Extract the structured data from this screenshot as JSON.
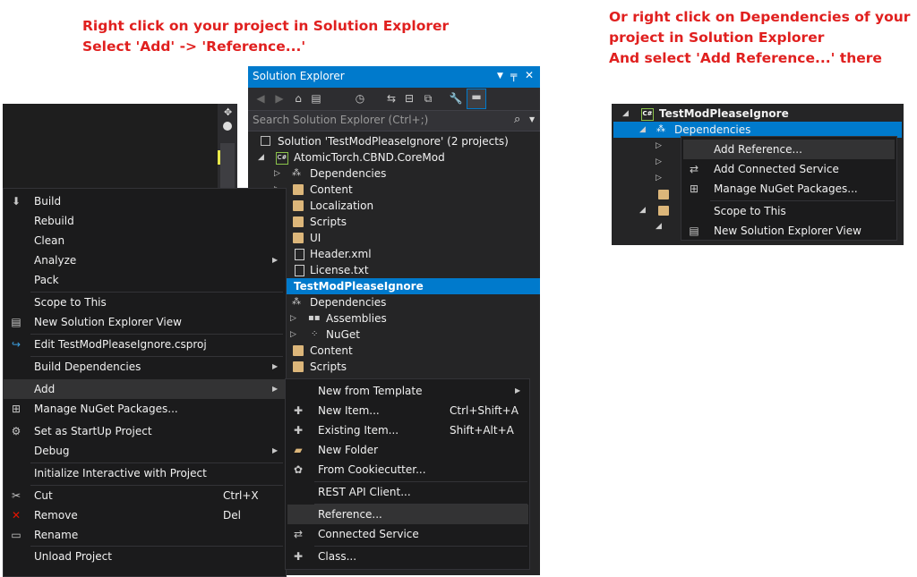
{
  "instructions": {
    "left": [
      "Right click on your project in Solution Explorer",
      "Select 'Add' -> 'Reference...'"
    ],
    "right": [
      "Or right click on Dependencies of your",
      "project in Solution Explorer",
      "And select 'Add Reference...' there"
    ]
  },
  "solution_explorer": {
    "title": "Solution Explorer",
    "search_placeholder": "Search Solution Explorer (Ctrl+;)",
    "tree": [
      {
        "label": "Solution 'TestModPleaseIgnore' (2 projects)",
        "icon": "solution-icon"
      },
      {
        "label": "AtomicTorch.CBND.CoreMod",
        "icon": "csharp-project-icon"
      },
      {
        "label": "Dependencies",
        "icon": "dependencies-icon"
      },
      {
        "label": "Content",
        "icon": "folder-icon"
      },
      {
        "label": "Localization",
        "icon": "folder-icon"
      },
      {
        "label": "Scripts",
        "icon": "folder-icon"
      },
      {
        "label": "UI",
        "icon": "folder-icon"
      },
      {
        "label": "Header.xml",
        "icon": "xml-file-icon"
      },
      {
        "label": "License.txt",
        "icon": "text-file-icon"
      },
      {
        "label": "TestModPleaseIgnore",
        "icon": "csharp-project-icon"
      },
      {
        "label": "Dependencies",
        "icon": "dependencies-icon"
      },
      {
        "label": "Assemblies",
        "icon": "assemblies-icon"
      },
      {
        "label": "NuGet",
        "icon": "nuget-icon"
      },
      {
        "label": "Content",
        "icon": "folder-icon"
      },
      {
        "label": "Scripts",
        "icon": "folder-icon"
      }
    ]
  },
  "context_menu": {
    "items": [
      {
        "label": "Build",
        "icon": "build-icon"
      },
      {
        "label": "Rebuild"
      },
      {
        "label": "Clean"
      },
      {
        "label": "Analyze"
      },
      {
        "label": "Pack"
      },
      {
        "label": "Scope to This"
      },
      {
        "label": "New Solution Explorer View",
        "icon": "new-view-icon"
      },
      {
        "label": "Edit TestModPleaseIgnore.csproj",
        "icon": "edit-icon"
      },
      {
        "label": "Build Dependencies"
      },
      {
        "label": "Add"
      },
      {
        "label": "Manage NuGet Packages...",
        "icon": "nuget-icon"
      },
      {
        "label": "Set as StartUp Project",
        "icon": "gear-icon"
      },
      {
        "label": "Debug"
      },
      {
        "label": "Initialize Interactive with Project"
      },
      {
        "label": "Cut",
        "icon": "cut-icon",
        "shortcut": "Ctrl+X"
      },
      {
        "label": "Remove",
        "icon": "remove-icon",
        "shortcut": "Del"
      },
      {
        "label": "Rename",
        "icon": "rename-icon"
      },
      {
        "label": "Unload Project"
      }
    ]
  },
  "add_submenu": {
    "items": [
      {
        "label": "New from Template"
      },
      {
        "label": "New Item...",
        "shortcut": "Ctrl+Shift+A"
      },
      {
        "label": "Existing Item...",
        "shortcut": "Shift+Alt+A"
      },
      {
        "label": "New Folder"
      },
      {
        "label": "From Cookiecutter..."
      },
      {
        "label": "REST API Client..."
      },
      {
        "label": "Reference..."
      },
      {
        "label": "Connected Service"
      },
      {
        "label": "Class..."
      }
    ]
  },
  "right_panel": {
    "project": "TestModPleaseIgnore",
    "dependencies": "Dependencies",
    "menu": [
      "Add Reference...",
      "Add Connected Service",
      "Manage NuGet Packages...",
      "Scope to This",
      "New Solution Explorer View"
    ]
  },
  "colors": {
    "accent": "#007acc",
    "instruction_text": "#e0201f",
    "menu_bg": "#1b1b1c"
  }
}
